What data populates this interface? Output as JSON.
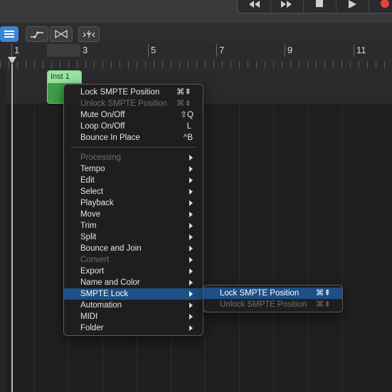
{
  "ruler": {
    "bars": [
      "1",
      "3",
      "5",
      "7",
      "9",
      "11"
    ]
  },
  "region": {
    "name": "Inst 1"
  },
  "context_menu": {
    "items": [
      {
        "label": "Lock SMPTE Position",
        "shortcut": "⌘⇞",
        "enabled": true
      },
      {
        "label": "Unlock SMPTE Position",
        "shortcut": "⌘⇟",
        "enabled": false
      },
      {
        "label": "Mute On/Off",
        "shortcut": "⇧Q",
        "enabled": true
      },
      {
        "label": "Loop On/Off",
        "shortcut": "L",
        "enabled": true
      },
      {
        "label": "Bounce In Place",
        "shortcut": "^B",
        "enabled": true
      },
      {
        "label": "Processing",
        "submenu": true,
        "enabled": false
      },
      {
        "label": "Tempo",
        "submenu": true,
        "enabled": true
      },
      {
        "label": "Edit",
        "submenu": true,
        "enabled": true
      },
      {
        "label": "Select",
        "submenu": true,
        "enabled": true
      },
      {
        "label": "Playback",
        "submenu": true,
        "enabled": true
      },
      {
        "label": "Move",
        "submenu": true,
        "enabled": true
      },
      {
        "label": "Trim",
        "submenu": true,
        "enabled": true
      },
      {
        "label": "Split",
        "submenu": true,
        "enabled": true
      },
      {
        "label": "Bounce and Join",
        "submenu": true,
        "enabled": true
      },
      {
        "label": "Convert",
        "submenu": true,
        "enabled": false
      },
      {
        "label": "Export",
        "submenu": true,
        "enabled": true
      },
      {
        "label": "Name and Color",
        "submenu": true,
        "enabled": true
      },
      {
        "label": "SMPTE Lock",
        "submenu": true,
        "enabled": true,
        "highlighted": true
      },
      {
        "label": "Automation",
        "submenu": true,
        "enabled": true
      },
      {
        "label": "MIDI",
        "submenu": true,
        "enabled": true
      },
      {
        "label": "Folder",
        "submenu": true,
        "enabled": true
      }
    ]
  },
  "submenu": {
    "items": [
      {
        "label": "Lock SMPTE Position",
        "shortcut": "⌘⇞",
        "enabled": true,
        "highlighted": true
      },
      {
        "label": "Unlock SMPTE Position",
        "shortcut": "⌘⇟",
        "enabled": false
      }
    ]
  },
  "colors": {
    "region_green": "#3fa049",
    "menu_highlight": "#1e4f86",
    "record_red": "#e0443e"
  }
}
